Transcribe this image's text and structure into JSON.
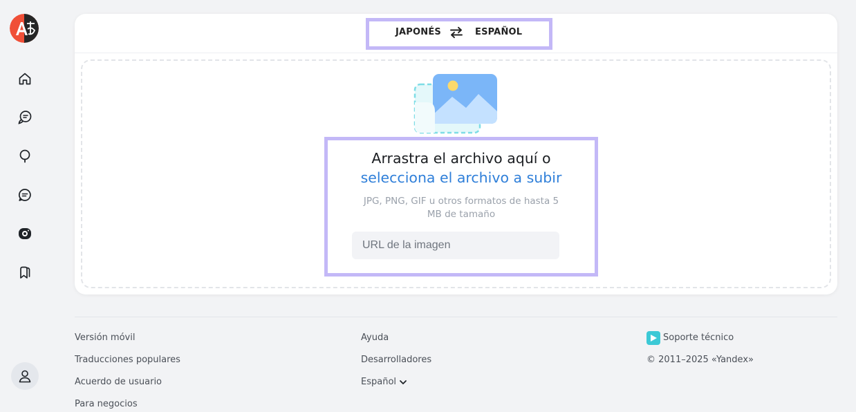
{
  "language_bar": {
    "source": "JAPONÉS",
    "target": "ESPAÑOL"
  },
  "upload": {
    "title_line1": "Arrastra el archivo aquí o",
    "title_link": "selecciona el archivo a subir",
    "hint": "JPG, PNG, GIF u otros formatos de hasta 5 MB de tamaño",
    "url_placeholder": "URL de la imagen"
  },
  "footer": {
    "col1": [
      "Versión móvil",
      "Traducciones populares",
      "Acuerdo de usuario",
      "Para negocios"
    ],
    "col2": [
      "Ayuda",
      "Desarrolladores"
    ],
    "language_select": "Español",
    "support": "Soporte técnico",
    "copyright": "© 2011–2025 «Yandex»"
  },
  "icons": {
    "sidebar": [
      "home-icon",
      "dialog-icon",
      "bulb-icon",
      "chat-icon",
      "camera-icon",
      "bookmarks-icon"
    ],
    "logo": "translate-logo-icon",
    "swap": "swap-arrows-icon",
    "user": "user-icon"
  },
  "colors": {
    "accent_link": "#2f7fd9",
    "highlight": "#c3b8f7",
    "logo_red": "#f04f37",
    "support": "#3cc9d6"
  }
}
